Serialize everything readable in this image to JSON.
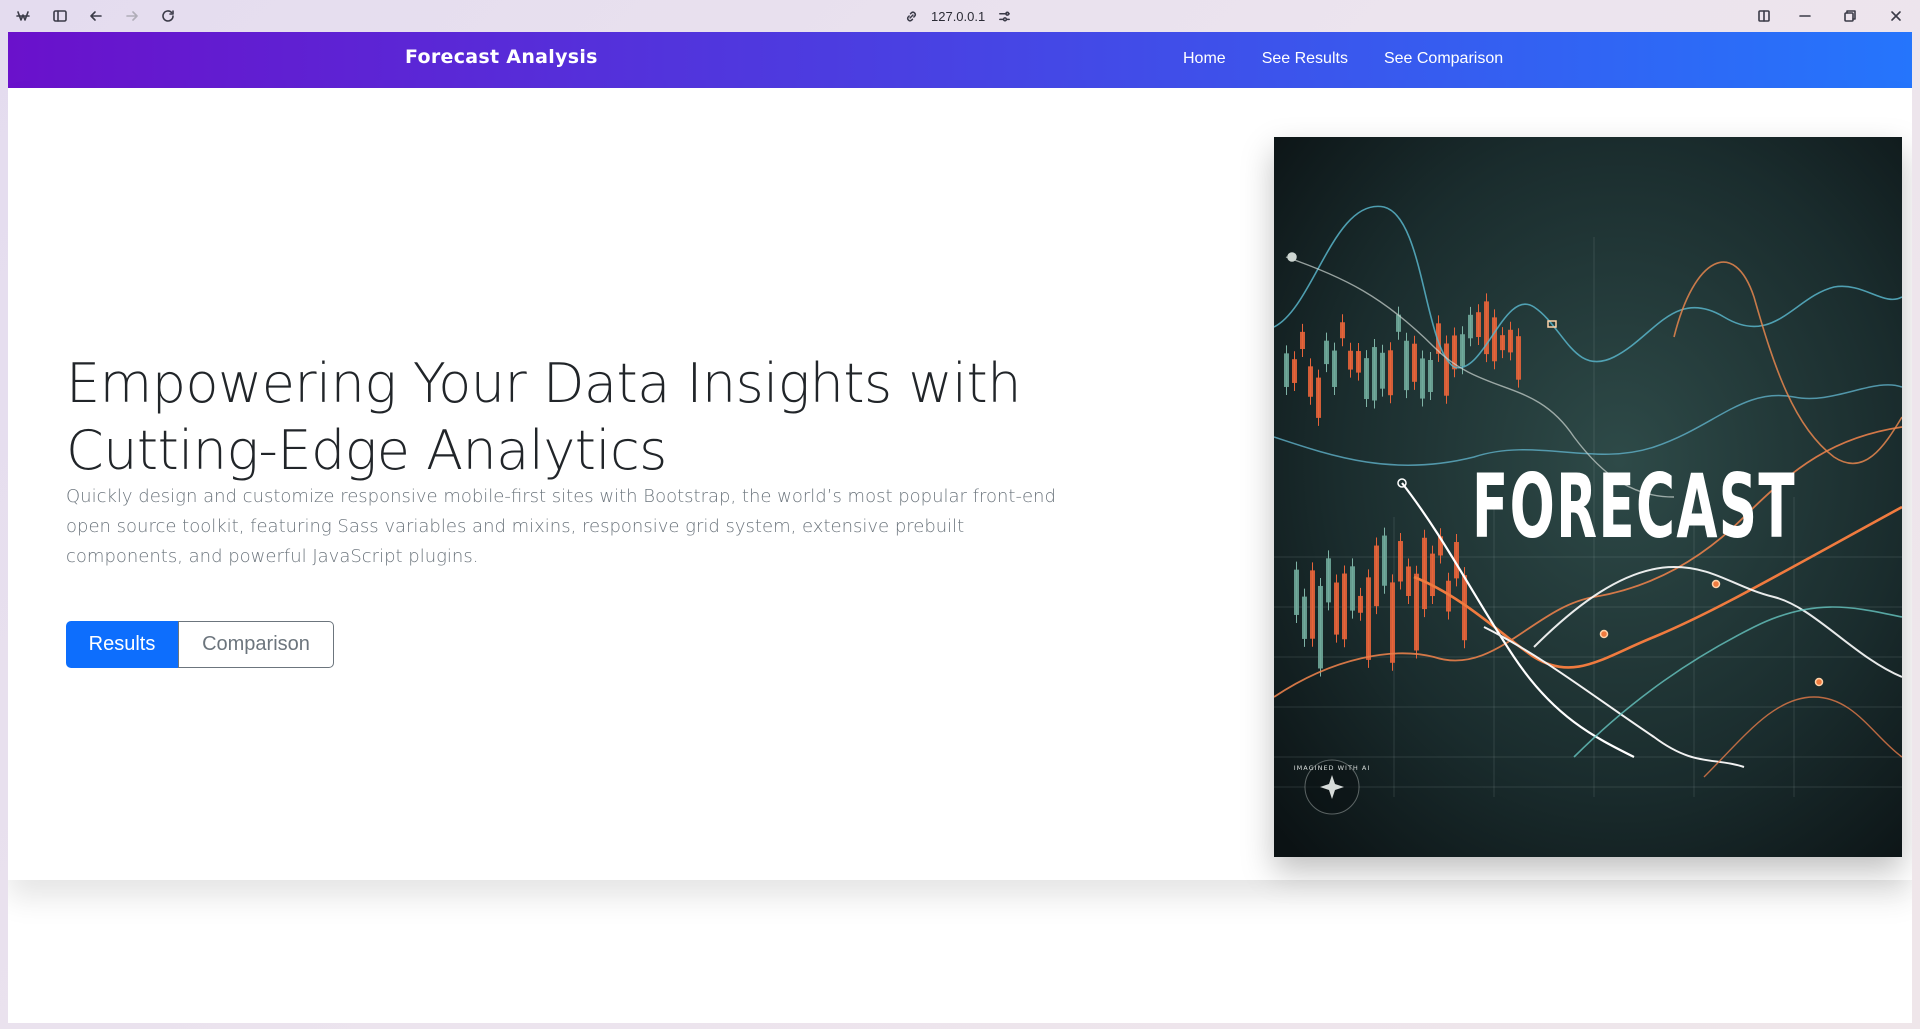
{
  "browser": {
    "address": "127.0.0.1",
    "icons": [
      "app-menu-icon",
      "sidebar-toggle-icon",
      "back-arrow-icon",
      "forward-arrow-icon",
      "reload-icon",
      "link-icon",
      "site-settings-icon",
      "split-view-icon",
      "minimize-icon",
      "restore-icon",
      "close-icon"
    ]
  },
  "navbar": {
    "brand": "Forecast Analysis",
    "links": [
      {
        "label": "Home"
      },
      {
        "label": "See Results"
      },
      {
        "label": "See Comparison"
      }
    ],
    "gradient_start": "#6a11cb",
    "gradient_end": "#2575fc"
  },
  "hero": {
    "title": "Empowering Your Data Insights with Cutting-Edge Analytics",
    "lead": "Quickly design and customize responsive mobile-first sites with Bootstrap, the world’s most popular front-end open source toolkit, featuring Sass variables and mixins, responsive grid system, extensive prebuilt components, and powerful JavaScript plugins.",
    "primary_button": "Results",
    "secondary_button": "Comparison",
    "primary_color": "#0d6efd",
    "image": {
      "overlay_text": "FORECAST",
      "badge_text": "IMAGINED WITH AI"
    }
  }
}
